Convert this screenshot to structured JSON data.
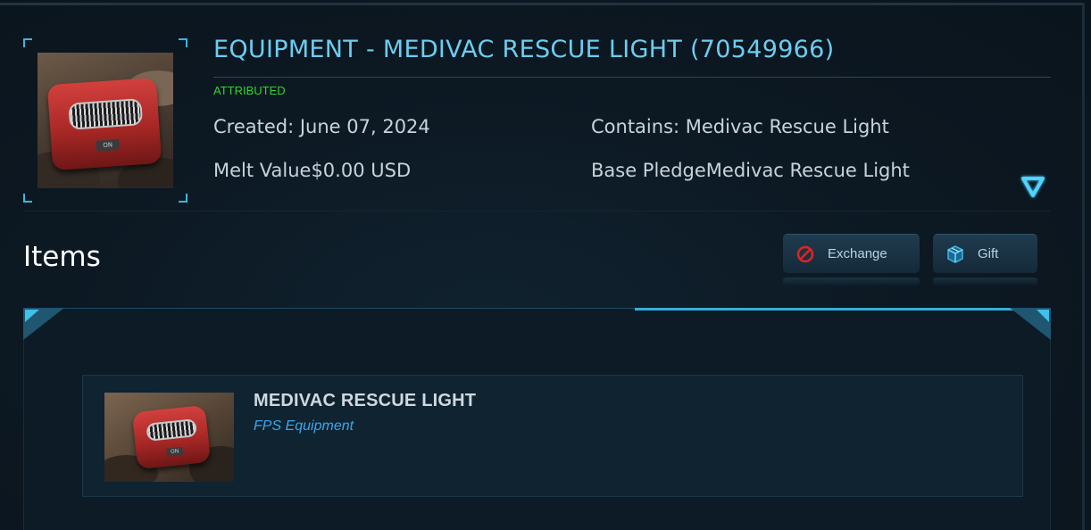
{
  "header": {
    "title": "EQUIPMENT - MEDIVAC RESCUE LIGHT (70549966)",
    "status": "ATTRIBUTED",
    "created": "Created: June 07, 2024",
    "melt_value": "Melt Value$0.00 USD",
    "contains": "Contains: Medivac Rescue Light",
    "base_pledge": "Base PledgeMedivac Rescue Light",
    "thumbnail_badge": "ON",
    "expand_icon": "triangle-down-icon"
  },
  "items_section": {
    "title": "Items",
    "actions": [
      {
        "label": "Exchange",
        "icon": "no-entry-icon",
        "icon_color": "#e02424"
      },
      {
        "label": "Gift",
        "icon": "gift-box-icon",
        "icon_color": "#3fb6e8"
      }
    ],
    "list": [
      {
        "name": "MEDIVAC RESCUE LIGHT",
        "type": "FPS Equipment",
        "thumbnail_badge": "ON"
      }
    ]
  },
  "colors": {
    "accent": "#39b8e0",
    "title": "#6ccdf1",
    "attributed": "#2fd62f",
    "item_type": "#3aa8ec",
    "background": "#0c1822"
  }
}
